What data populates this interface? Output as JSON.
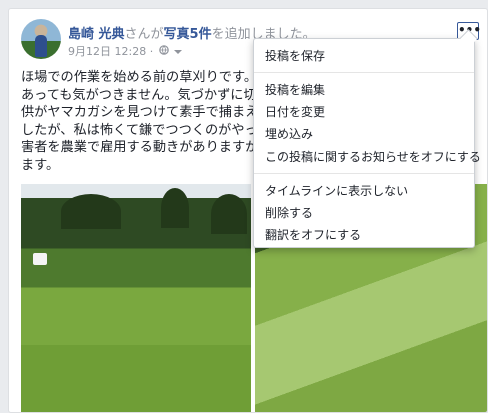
{
  "post": {
    "author": "島崎 光典",
    "action_pre": "さんが",
    "photos_link": "写真5件",
    "action_post": "を追加しました。",
    "timestamp": "9月12日 12:28",
    "privacy_separator": "·",
    "privacy_icon": "globe-icon",
    "dropdown_icon": "caret-down-icon",
    "more_label": "•••",
    "text_lines": [
      "ほ場での作業を始める前の草刈りです。",
      "あっても気がつきません。気づかずに切",
      "供がヤマカガシを見つけて素手で捕まえ",
      "したが、私は怖くて鎌でつつくのがやっ",
      "害者を農業で雇用する動きがありますが",
      "ます。"
    ]
  },
  "menu": {
    "group1": [
      "投稿を保存"
    ],
    "group2": [
      "投稿を編集",
      "日付を変更",
      "埋め込み",
      "この投稿に関するお知らせをオフにする"
    ],
    "group3": [
      "タイムラインに表示しない",
      "削除する",
      "翻訳をオフにする"
    ]
  },
  "colors": {
    "link": "#365899",
    "muted": "#90949c",
    "text": "#1d2129"
  }
}
